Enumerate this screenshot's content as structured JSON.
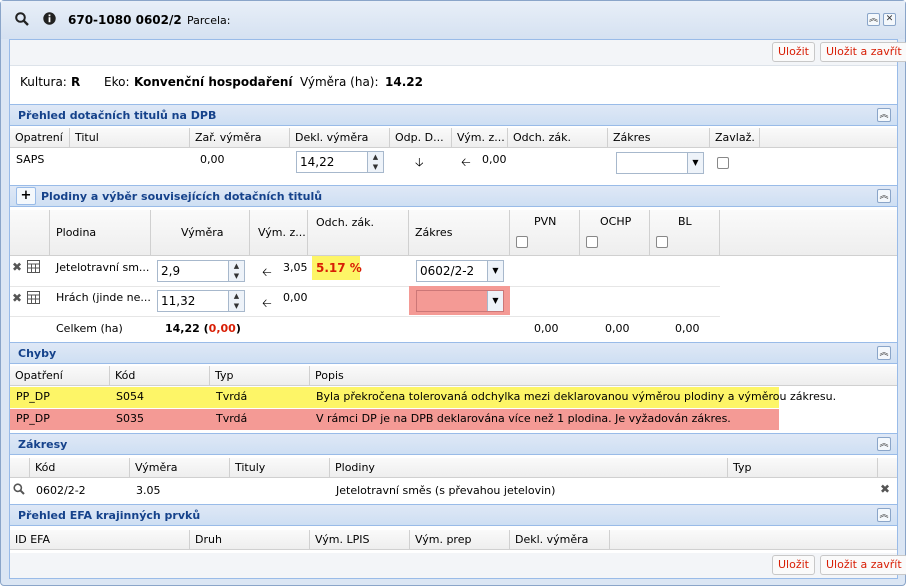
{
  "title": {
    "code": "670-1080 0602/2",
    "parcela_label": "Parcela:"
  },
  "toolbar": {
    "save": "Uložit",
    "save_close": "Uložit a zavřít"
  },
  "info": {
    "kultura_label": "Kultura:",
    "kultura_value": "R",
    "eko_label": "Eko:",
    "eko_value": "Konvenční hospodaření",
    "vymera_label": "Výměra (ha):",
    "vymera_value": "14.22"
  },
  "dpb": {
    "title": "Přehled dotačních titulů na DPB",
    "columns": [
      "Opatrení",
      "Titul",
      "Zař. výměra",
      "Dekl. výměra",
      "Odp. D...",
      "Vým. z...",
      "Odch. zák.",
      "Zákres",
      "Zavlaž."
    ],
    "row": {
      "opatreni": "SAPS",
      "zar_vymera": "0,00",
      "dekl_vymera": "14,22",
      "vym_z": "0,00"
    }
  },
  "plodiny": {
    "title": "Plodiny a výběr souvisejících dotačních titulů",
    "add_symbol": "+",
    "columns": {
      "plodina": "Plodina",
      "vymera": "Výměra",
      "vym_z": "Vým. z...",
      "odch": "Odch. zák.",
      "zakres": "Zákres",
      "pvn": "PVN",
      "ochp": "OCHP",
      "bl": "BL"
    },
    "rows": [
      {
        "plodina": "Jetelotravní sm...",
        "vymera": "2,9",
        "vym_z": "3,05",
        "odch": "5.17 %",
        "zakres": "0602/2-2"
      },
      {
        "plodina": "Hrách (jinde ne...",
        "vymera": "11,32",
        "vym_z": "0,00",
        "odch": "",
        "zakres": ""
      }
    ],
    "total": {
      "label": "Celkem (ha)",
      "value": "14,22",
      "open": "(",
      "diff": "0,00",
      "close": ")",
      "pvn": "0,00",
      "ochp": "0,00",
      "bl": "0,00"
    }
  },
  "chyby": {
    "title": "Chyby",
    "columns": [
      "Opatření",
      "Kód",
      "Typ",
      "Popis"
    ],
    "rows": [
      {
        "opatreni": "PP_DP",
        "kod": "S054",
        "typ": "Tvrdá",
        "popis": "Byla překročena tolerovaná odchylka mezi deklarovanou výměrou plodiny a výměrou zákresu.",
        "color": "#fdf567"
      },
      {
        "opatreni": "PP_DP",
        "kod": "S035",
        "typ": "Tvrdá",
        "popis": "V rámci DP je na DPB deklarována více než 1 plodina. Je vyžadován zákres.",
        "color": "#f49a95"
      }
    ]
  },
  "zakresy": {
    "title": "Zákresy",
    "columns": [
      "Kód",
      "Výměra",
      "Tituly",
      "Plodiny",
      "Typ"
    ],
    "row": {
      "kod": "0602/2-2",
      "vymera": "3.05",
      "tituly": "",
      "plodiny": "Jetelotravní směs (s převahou jetelovin)",
      "typ": ""
    }
  },
  "efa": {
    "title": "Přehled EFA krajinných prvků",
    "columns": [
      "ID EFA",
      "Druh",
      "Vým. LPIS",
      "Vým. prep",
      "Dekl. výměra"
    ]
  },
  "colors": {
    "header_text": "#15428b",
    "error_red": "#d81e05",
    "warn_yellow": "#fdf567",
    "err_pink": "#f49a95"
  }
}
